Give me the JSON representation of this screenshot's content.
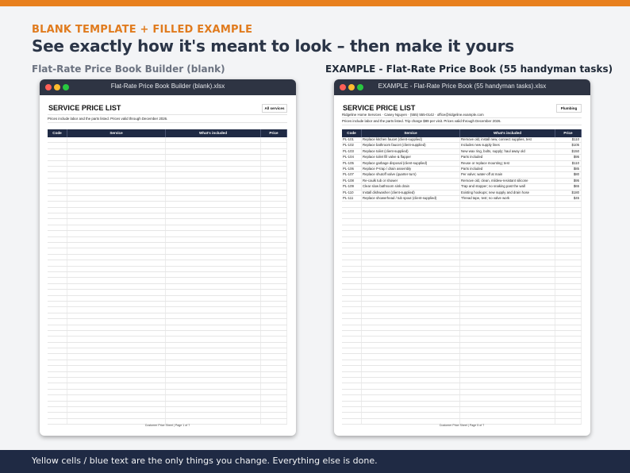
{
  "eyebrow": "BLANK TEMPLATE  +  FILLED EXAMPLE",
  "headline": "See exactly how it's meant to look – then make it yours",
  "colors": {
    "accent": "#e8801e",
    "navy": "#1f2a44",
    "window_bar": "#2e3443"
  },
  "left_panel": {
    "heading": "Flat-Rate Price Book Builder (blank)",
    "window_title": "Flat-Rate Price Book Builder (blank).xlsx",
    "sheet_title": "SERVICE PRICE LIST",
    "category": "All services",
    "meta_lines": [
      "Prices include labor and the parts listed. Prices valid through December 2026."
    ],
    "columns": [
      "Code",
      "Service",
      "What's included",
      "Price"
    ],
    "rows": [],
    "footer": "Customer Price Sheet  |  Page 1 of 7"
  },
  "right_panel": {
    "heading": "EXAMPLE - Flat-Rate Price Book (55 handyman tasks)",
    "window_title": "EXAMPLE - Flat-Rate Price Book (55 handyman tasks).xlsx",
    "sheet_title": "SERVICE PRICE LIST",
    "category": "Plumbing",
    "meta_lines": [
      "Ridgeline Home Services  ·  Casey Nguyen  ·  (555) 555-0142  ·  office@ridgeline.example.com",
      "Prices include labor and the parts listed. Trip charge $89 per visit. Prices valid through December 2026."
    ],
    "columns": [
      "Code",
      "Service",
      "What's included",
      "Price"
    ],
    "rows": [
      [
        "PL-101",
        "Replace kitchen faucet (client-supplied)",
        "Remove old, install new, connect supplies, test",
        "$110"
      ],
      [
        "PL-102",
        "Replace bathroom faucet (client-supplied)",
        "Includes new supply lines",
        "$105"
      ],
      [
        "PL-103",
        "Replace toilet (client-supplied)",
        "New wax ring, bolts, supply; haul away old",
        "$150"
      ],
      [
        "PL-104",
        "Replace toilet fill valve & flapper",
        "Parts included",
        "$95"
      ],
      [
        "PL-105",
        "Replace garbage disposal (client-supplied)",
        "Reuse or replace mounting; test",
        "$110"
      ],
      [
        "PL-106",
        "Replace P-trap / drain assembly",
        "Parts included",
        "$85"
      ],
      [
        "PL-107",
        "Replace shutoff valve (quarter-turn)",
        "Per valve; water-off at main",
        "$80"
      ],
      [
        "PL-108",
        "Re-caulk tub or shower",
        "Remove old, clean, mildew-resistant silicone",
        "$95"
      ],
      [
        "PL-109",
        "Clear slow bathroom sink drain",
        "Trap and stopper; no snaking past the wall",
        "$65"
      ],
      [
        "PL-110",
        "Install dishwasher (client-supplied)",
        "Existing hookups; new supply and drain hose",
        "$180"
      ],
      [
        "PL-111",
        "Replace showerhead / tub spout (client-supplied)",
        "Thread tape, test; no valve work",
        "$45"
      ]
    ],
    "footer": "Customer Price Sheet  |  Page 5 of 7"
  },
  "bottom_note": "Yellow cells / blue text are the only things you change. Everything else is done."
}
